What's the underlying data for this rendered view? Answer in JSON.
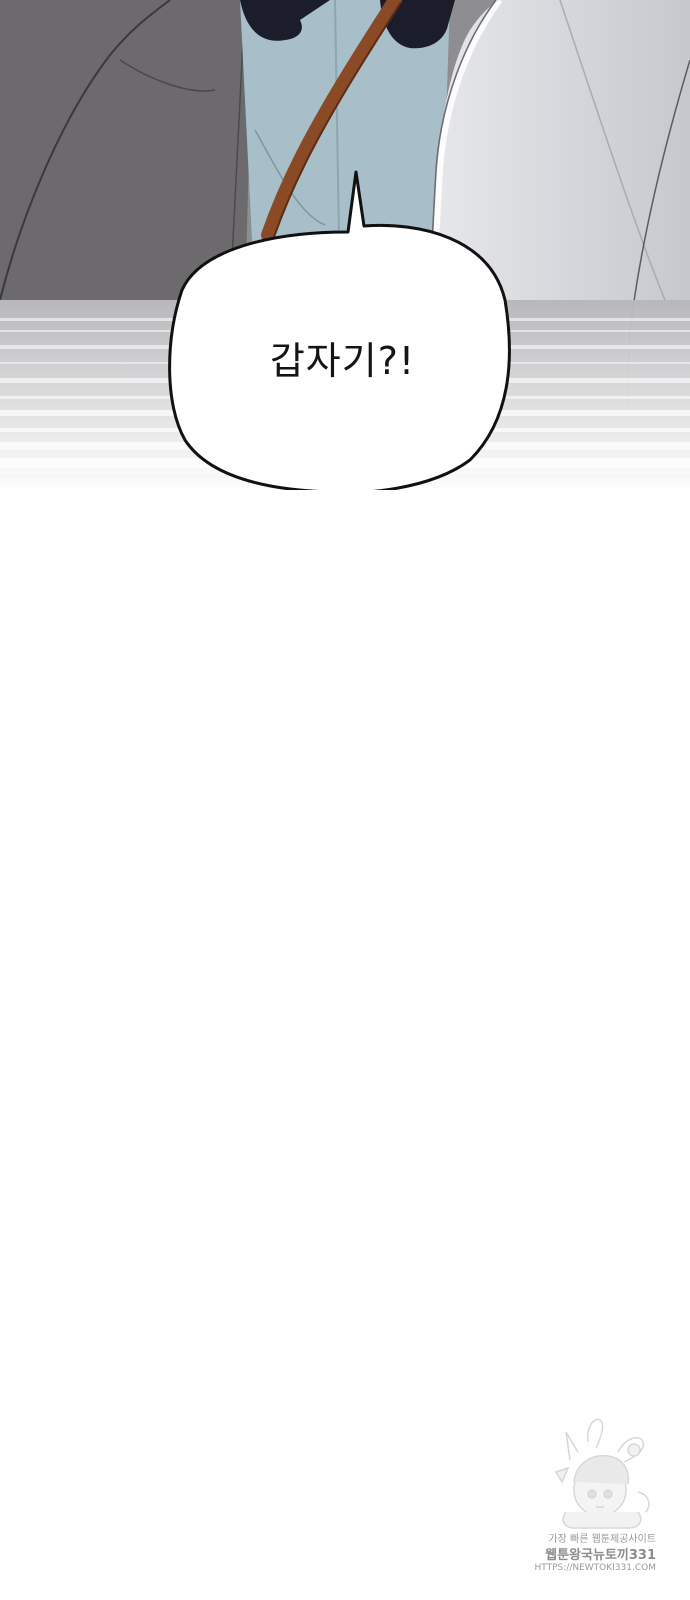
{
  "comic": {
    "speech_bubble_text": "갑자기?!"
  },
  "watermark": {
    "line1": "가장 빠른 웹툰제공사이트",
    "line2": "웹툰왕국뉴토끼331",
    "line3": "HTTPS://NEWTOKI331.COM"
  },
  "colors": {
    "dark_cloak": "#6c6a6d",
    "light_cloak": "#d0d2d7",
    "shirt_blue": "#a8bfc9",
    "hair": "#1b1d2a",
    "strap": "#8a4a26",
    "background": "#ffffff"
  }
}
